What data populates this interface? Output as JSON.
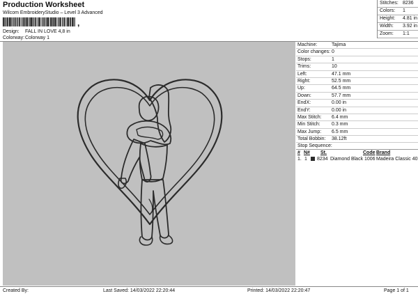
{
  "header": {
    "title": "Production Worksheet",
    "subtitle": "Wilcom EmbroideryStudio – Level 3 Advanced",
    "barcode_mark": ","
  },
  "design": {
    "label": "Design:",
    "value": "FALL IN LOVE 4,8 in"
  },
  "colorway": {
    "label": "Colorway:",
    "value": "Colorway 1"
  },
  "stats": [
    {
      "label": "Stitches:",
      "value": "8236"
    },
    {
      "label": "Colors:",
      "value": "1"
    },
    {
      "label": "Height:",
      "value": "4.81 in"
    },
    {
      "label": "Width:",
      "value": "3.92 in"
    },
    {
      "label": "Zoom:",
      "value": "1:1"
    }
  ],
  "machine_info": [
    {
      "label": "Machine:",
      "value": "Tajima"
    },
    {
      "label": "Color changes:",
      "value": "0"
    },
    {
      "label": "Stops:",
      "value": "1"
    },
    {
      "label": "Trims:",
      "value": "10"
    },
    {
      "label": "Left:",
      "value": "47.1 mm"
    },
    {
      "label": "Right:",
      "value": "52.5 mm"
    },
    {
      "label": "Up:",
      "value": "64.5 mm"
    },
    {
      "label": "Down:",
      "value": "57.7 mm"
    },
    {
      "label": "EndX:",
      "value": "0.00 in"
    },
    {
      "label": "EndY:",
      "value": "0.00 in"
    },
    {
      "label": "Max Stitch:",
      "value": "6.4 mm"
    },
    {
      "label": "Min Stitch:",
      "value": "0.3 mm"
    },
    {
      "label": "Max Jump:",
      "value": "6.5 mm"
    },
    {
      "label": "Total Bobbin:",
      "value": "38.12ft"
    }
  ],
  "stop_sequence": {
    "title": "Stop Sequence:",
    "headers": {
      "num": "#",
      "n": "N#",
      "st": "St.",
      "code": "Code",
      "brand": "Brand"
    },
    "rows": [
      {
        "num": "1.",
        "n": "1",
        "swatch_color": "#2b2b2b",
        "st": "8234",
        "name": "Diamond Black",
        "code": "1006",
        "brand": "Madeira Classic 40"
      }
    ]
  },
  "design_preview": {
    "fabric_color": "#c0c0c0",
    "thread_color": "#2b2b2b"
  },
  "footer": {
    "created_by": "Created By:",
    "last_saved": "Last Saved: 14/03/2022 22:20:44",
    "printed": "Printed: 14/03/2022 22:20:47",
    "page": "Page 1 of 1"
  }
}
